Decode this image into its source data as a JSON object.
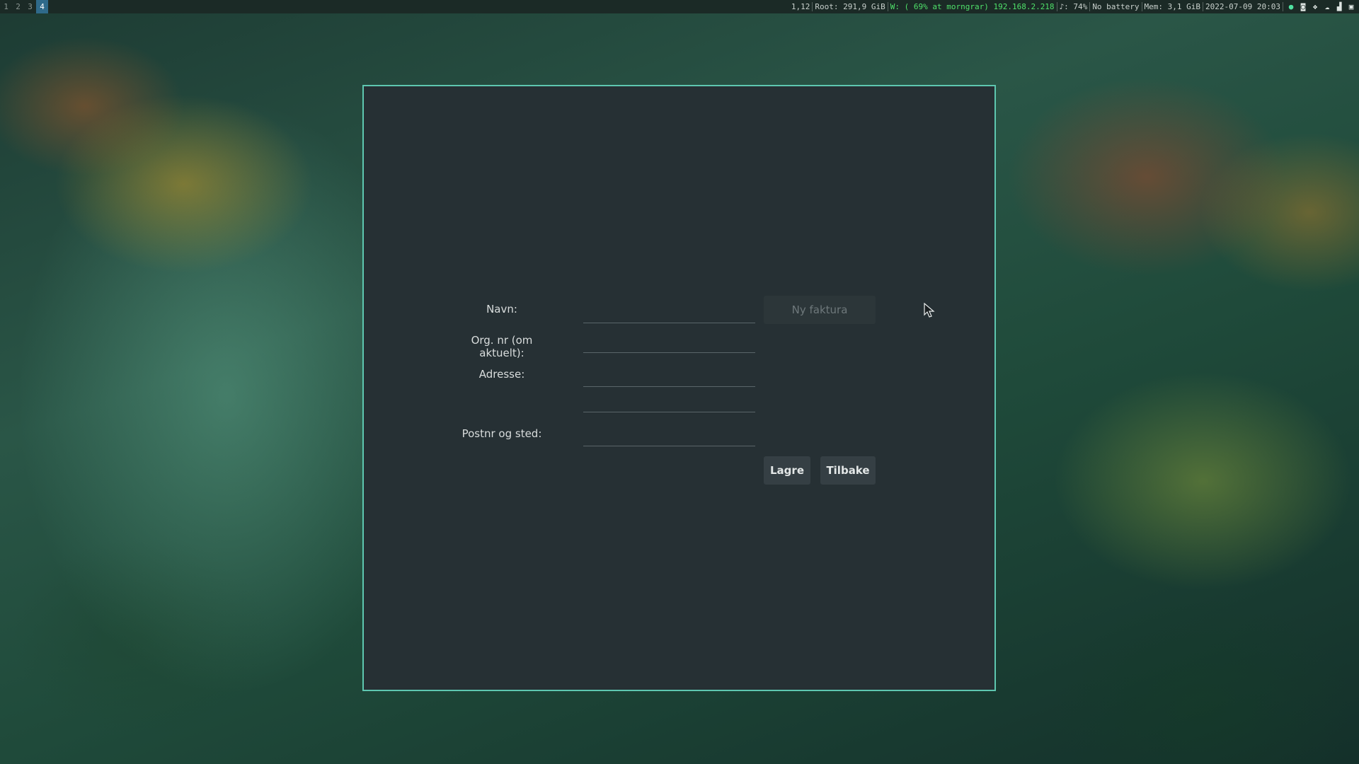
{
  "topbar": {
    "workspaces": [
      "1",
      "2",
      "3",
      "4"
    ],
    "active_workspace": "4",
    "status": {
      "position": "1,12",
      "root": "Root: 291,9 GiB",
      "wifi": "W: ( 69% at morngrar) 192.168.2.218",
      "volume": "♪: 74%",
      "battery": "No battery",
      "memory": "Mem: 3,1 GiB",
      "datetime": "2022-07-09 20:03"
    },
    "tray_icons": [
      "globe-icon",
      "discord-icon",
      "dropbox-icon",
      "cloud-icon",
      "signal-icon",
      "settings-icon"
    ],
    "accent_color": "#4fe06a"
  },
  "form": {
    "name_label": "Navn:",
    "name_value": "",
    "org_label": "Org. nr (om aktuelt):",
    "org_value": "",
    "address_label": "Adresse:",
    "address_line1": "",
    "address_line2": "",
    "postal_label": "Postnr og sted:",
    "postal_value": "",
    "new_invoice_button": "Ny faktura",
    "save_button": "Lagre",
    "back_button": "Tilbake"
  },
  "colors": {
    "window_bg": "#263034",
    "window_border": "#5ec7b0"
  }
}
